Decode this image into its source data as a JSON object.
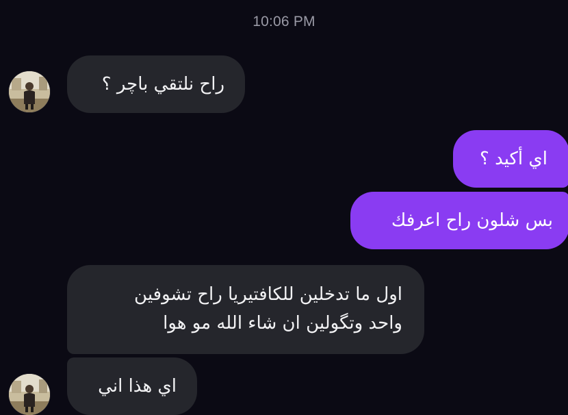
{
  "thread": {
    "timestamp": "10:06 PM"
  },
  "messages": [
    {
      "direction": "incoming",
      "text": "راح نلتقي باچر ؟"
    },
    {
      "direction": "outgoing",
      "text": "اي أكيد ؟"
    },
    {
      "direction": "outgoing",
      "text": "بس شلون راح اعرفك"
    },
    {
      "direction": "incoming",
      "lines": [
        "اول ما تدخلين للكافتيريا راح تشوفين",
        "واحد وتگولين ان شاء الله مو هوا"
      ]
    },
    {
      "direction": "incoming",
      "text": "اي هذا اني"
    }
  ],
  "colors": {
    "background": "#0b0a14",
    "incoming_bubble": "#25262c",
    "outgoing_bubble": "#8a3cf2",
    "timestamp_text": "#9a9aa6"
  },
  "icons": {
    "contact_avatar": "person-photo-avatar"
  }
}
